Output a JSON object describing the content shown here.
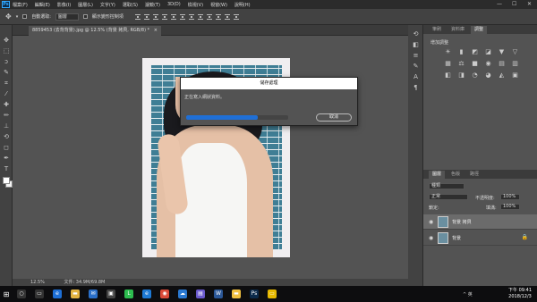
{
  "menubar": {
    "logo": "Ps",
    "items": [
      "檔案(F)",
      "編輯(E)",
      "影像(I)",
      "圖層(L)",
      "文字(Y)",
      "選取(S)",
      "濾鏡(T)",
      "3D(D)",
      "檢視(V)",
      "視窗(W)",
      "說明(H)"
    ],
    "min": "—",
    "max": "☐",
    "close": "✕"
  },
  "options": {
    "auto_select_label": "自動選取:",
    "auto_select_value": "圖層",
    "show_transform_label": "顯示變形控制項"
  },
  "document": {
    "tab_title": "8859453 (去背背景).jpg @ 12.5% (背景 拷貝, RGB/8) *",
    "tab_close": "×"
  },
  "dialog": {
    "title": "儲存處理",
    "message": "正在寫入網狀資料。",
    "progress": 0.7,
    "cancel_label": "取消"
  },
  "panels": {
    "top_tabs": [
      "筆刷",
      "資料庫",
      "調整"
    ],
    "adjust_title": "增加調整",
    "adjust_icons": [
      "☀",
      "▮",
      "◩",
      "◪",
      "▼",
      "▽",
      "▦",
      "⚖",
      "■",
      "◉",
      "▤",
      "▥",
      "◧",
      "◨",
      "◔",
      "◕",
      "◭",
      "▣"
    ],
    "layer_tabs": [
      "圖層",
      "色版",
      "路徑"
    ],
    "kind_label": "種類",
    "blend_mode": "正常",
    "opacity_label": "不透明度:",
    "opacity_value": "100%",
    "lock_label": "鎖定:",
    "fill_label": "填滿:",
    "fill_value": "100%",
    "layers": [
      {
        "name": "背景 拷貝",
        "selected": true,
        "locked": false
      },
      {
        "name": "背景",
        "selected": false,
        "locked": true
      }
    ]
  },
  "status": {
    "zoom": "12.5%",
    "doc_info": "文件: 34.9M/69.8M"
  },
  "taskbar": {
    "tray": "^ 英",
    "time": "下午 09:41",
    "date": "2018/12/3",
    "app_icons": [
      {
        "name": "search",
        "glyph": "○",
        "color": "#333"
      },
      {
        "name": "task-view",
        "glyph": "▭",
        "color": "#333"
      },
      {
        "name": "edge",
        "glyph": "e",
        "color": "#1d6fd6"
      },
      {
        "name": "explorer",
        "glyph": "▬",
        "color": "#e3b341"
      },
      {
        "name": "mail",
        "glyph": "✉",
        "color": "#2a6fc9"
      },
      {
        "name": "store",
        "glyph": "▣",
        "color": "#444"
      },
      {
        "name": "line",
        "glyph": "L",
        "color": "#2dbd4f"
      },
      {
        "name": "ie",
        "glyph": "e",
        "color": "#1e7ad6"
      },
      {
        "name": "chrome",
        "glyph": "◉",
        "color": "#d94a38"
      },
      {
        "name": "onedrive",
        "glyph": "☁",
        "color": "#2a78d0"
      },
      {
        "name": "photos",
        "glyph": "▤",
        "color": "#6a5acd"
      },
      {
        "name": "word",
        "glyph": "W",
        "color": "#2b5797"
      },
      {
        "name": "files",
        "glyph": "▬",
        "color": "#f0c040"
      },
      {
        "name": "photoshop",
        "glyph": "Ps",
        "color": "#0b2a4a"
      },
      {
        "name": "notes",
        "glyph": "▭",
        "color": "#e6b800"
      }
    ]
  }
}
